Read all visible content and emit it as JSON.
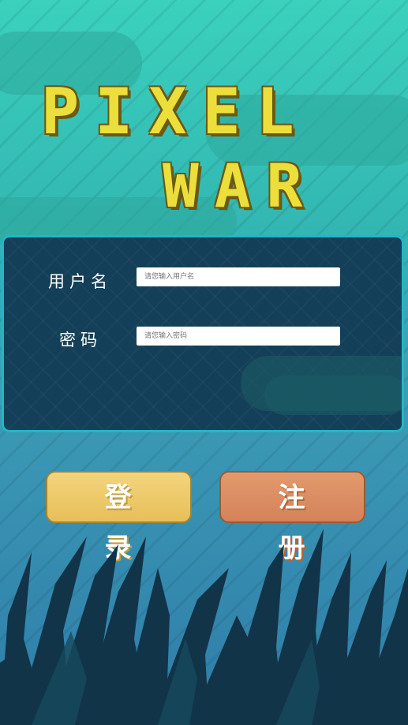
{
  "app": {
    "title_line1": "PIXEL",
    "title_line2": "WAR"
  },
  "login_form": {
    "username_label": "用户名",
    "username_placeholder": "请您输入用户名",
    "password_label": "密码",
    "password_placeholder": "请您输入密码"
  },
  "buttons": {
    "login_label": "登 录",
    "register_label": "注 册"
  },
  "colors": {
    "title": "#ecdf3c",
    "panel": "#143f58",
    "panel_border": "#22b6c8",
    "login_button": "#f0cc6c",
    "register_button": "#dd8f62",
    "background_top": "#3bd1bd",
    "background_bottom": "#2f7ca9"
  }
}
